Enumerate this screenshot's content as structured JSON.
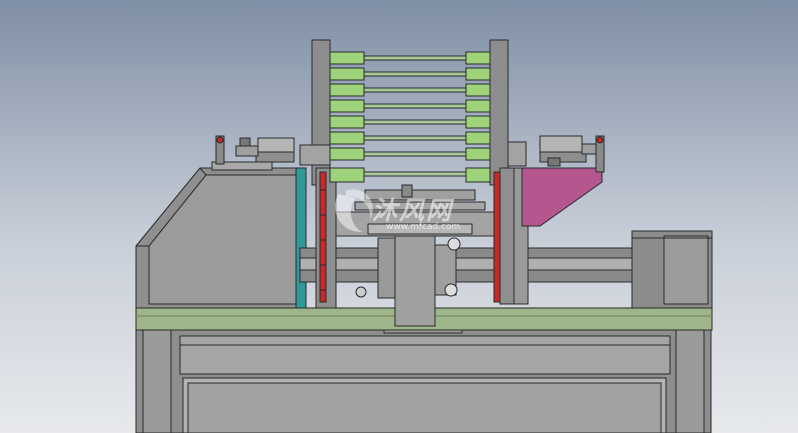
{
  "colors": {
    "background_top": "#7f8fa5",
    "background_bottom": "#e7e9ec",
    "metal": "#8f8f8f",
    "metal_light": "#a9a9a9",
    "metal_dark": "#6c6c6c",
    "base_plate": "#9fb58a",
    "clamp_block": "#9ed37c",
    "teal_strip": "#2f9a9a",
    "red_detail": "#c62a2a",
    "bracket": "#b4578e",
    "outline": "#2a2a2a"
  },
  "watermark": {
    "text": "沐风网",
    "url": "www.mfcad.com",
    "icon": "logo-mark"
  },
  "view": {
    "icon": "cad-assembly-front-view"
  }
}
